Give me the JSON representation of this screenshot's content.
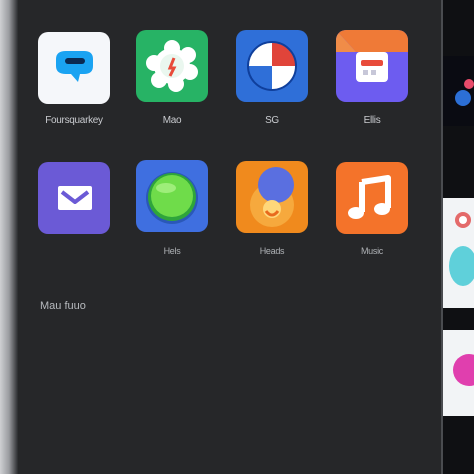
{
  "top_labels": [
    "",
    "",
    ""
  ],
  "apps": [
    {
      "label": "Foursquarkey",
      "icon": "chat-bubble-icon"
    },
    {
      "label": "Mao",
      "icon": "gear-flower-icon"
    },
    {
      "label": "SG",
      "icon": "pie-chart-icon"
    },
    {
      "label": "Ellis",
      "icon": "store-icon"
    },
    {
      "label": "",
      "icon": "envelope-icon"
    },
    {
      "label": "Hels",
      "icon": "green-circle-icon"
    },
    {
      "label": "Heads",
      "icon": "blob-icon"
    },
    {
      "label": "Music",
      "icon": "music-note-icon"
    }
  ],
  "section_label": "Mau fuuo",
  "colors": {
    "chat_bg": "#f5f7fa",
    "chat_accent": "#1aa3f2",
    "flower_bg": "#27b365",
    "chart_bg": "#2f6fd8",
    "store_bg": "#6d5cf0",
    "mail_bg": "#6b5ad6",
    "green_bg": "#3f6fe0",
    "blob_bg": "#f08a1d",
    "music_bg": "#f4732a"
  }
}
